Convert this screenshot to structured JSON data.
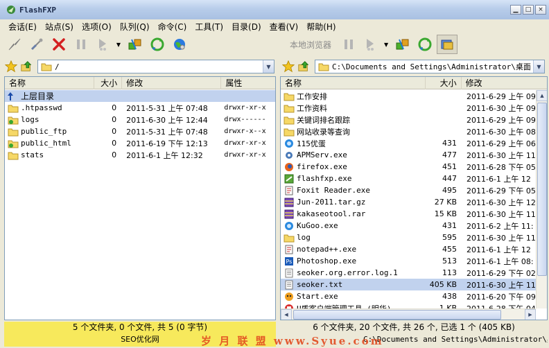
{
  "window": {
    "title": "FlashFXP",
    "minimize": "▁",
    "maximize": "□",
    "close": "×"
  },
  "menu": [
    "会话(E)",
    "站点(S)",
    "选项(O)",
    "队列(Q)",
    "命令(C)",
    "工具(T)",
    "目录(D)",
    "查看(V)",
    "帮助(H)"
  ],
  "toolbar_right": {
    "local_browser_label": "本地浏览器"
  },
  "remote": {
    "path": "/",
    "columns": {
      "name": "名称",
      "size": "大小",
      "modified": "修改",
      "attrs": "属性"
    },
    "parent_dir_label": "上层目录",
    "files": [
      {
        "name": ".htpasswd",
        "size": "0",
        "modified": "2011-5-31 上午 07:48",
        "attrs": "drwxr-xr-x",
        "icon": "folder"
      },
      {
        "name": "logs",
        "size": "0",
        "modified": "2011-6-30 上午 12:44",
        "attrs": "drwx------",
        "icon": "folder-link"
      },
      {
        "name": "public_ftp",
        "size": "0",
        "modified": "2011-5-31 上午 07:48",
        "attrs": "drwxr-x--x",
        "icon": "folder"
      },
      {
        "name": "public_html",
        "size": "0",
        "modified": "2011-6-19 下午 12:13",
        "attrs": "drwxr-xr-x",
        "icon": "folder-link"
      },
      {
        "name": "stats",
        "size": "0",
        "modified": "2011-6-1 上午 12:32",
        "attrs": "drwxr-xr-x",
        "icon": "folder"
      }
    ],
    "status_line1": "5 个文件夹, 0 个文件, 共 5 (0 字节)",
    "status_line2": "SEO优化网"
  },
  "local": {
    "path": "C:\\Documents and Settings\\Administrator\\桌面",
    "columns": {
      "name": "名称",
      "size": "大小",
      "modified": "修改"
    },
    "files": [
      {
        "name": "工作安排",
        "size": "",
        "modified": "2011-6-29 上午 09",
        "icon": "folder"
      },
      {
        "name": "工作资料",
        "size": "",
        "modified": "2011-6-30 上午 09",
        "icon": "folder"
      },
      {
        "name": "关键词排名跟踪",
        "size": "",
        "modified": "2011-6-29 上午 09",
        "icon": "folder"
      },
      {
        "name": "网站收录等查询",
        "size": "",
        "modified": "2011-6-30 上午 08",
        "icon": "folder"
      },
      {
        "name": "115优蛋",
        "size": "431",
        "modified": "2011-6-29 上午 06",
        "icon": "app-blue"
      },
      {
        "name": "APMServ.exe",
        "size": "477",
        "modified": "2011-6-30 上午 11",
        "icon": "app-gear"
      },
      {
        "name": "firefox.exe",
        "size": "451",
        "modified": "2011-6-28 下午 05",
        "icon": "app-firefox"
      },
      {
        "name": "flashfxp.exe",
        "size": "447",
        "modified": "2011-6-1 上午 12",
        "icon": "app-green"
      },
      {
        "name": "Foxit Reader.exe",
        "size": "495",
        "modified": "2011-6-29 下午 05",
        "icon": "app-doc"
      },
      {
        "name": "Jun-2011.tar.gz",
        "size": "27 KB",
        "modified": "2011-6-30 上午 12",
        "icon": "archive"
      },
      {
        "name": "kakaseotool.rar",
        "size": "15 KB",
        "modified": "2011-6-30 上午 11",
        "icon": "archive"
      },
      {
        "name": "KuGoo.exe",
        "size": "431",
        "modified": "2011-6-2 上午 11:",
        "icon": "app-blue"
      },
      {
        "name": "log",
        "size": "595",
        "modified": "2011-6-30 上午 11",
        "icon": "folder"
      },
      {
        "name": "notepad++.exe",
        "size": "455",
        "modified": "2011-6-1 上午 12",
        "icon": "app-doc"
      },
      {
        "name": "Photoshop.exe",
        "size": "513",
        "modified": "2011-6-1 上午 08:",
        "icon": "app-ps"
      },
      {
        "name": "seoker.org.error.log.1",
        "size": "113",
        "modified": "2011-6-29 下午 02",
        "icon": "text"
      },
      {
        "name": "seoker.txt",
        "size": "405 KB",
        "modified": "2011-6-30 上午 11",
        "icon": "text",
        "selected": true
      },
      {
        "name": "Start.exe",
        "size": "438",
        "modified": "2011-6-20 下午 09",
        "icon": "app-orange"
      },
      {
        "name": "U盾客户端管理工具 (明华)",
        "size": "1 KB",
        "modified": "2011-6-28 下午 04",
        "icon": "app-red"
      }
    ],
    "status_line1": "6 个文件夹, 20 个文件, 共 26 个, 已选 1 个 (405 KB)",
    "status_line2": "C:\\Documents and Settings\\Administrator\\桌面"
  },
  "watermark": "岁 月 联 盟  www.Syue.com"
}
